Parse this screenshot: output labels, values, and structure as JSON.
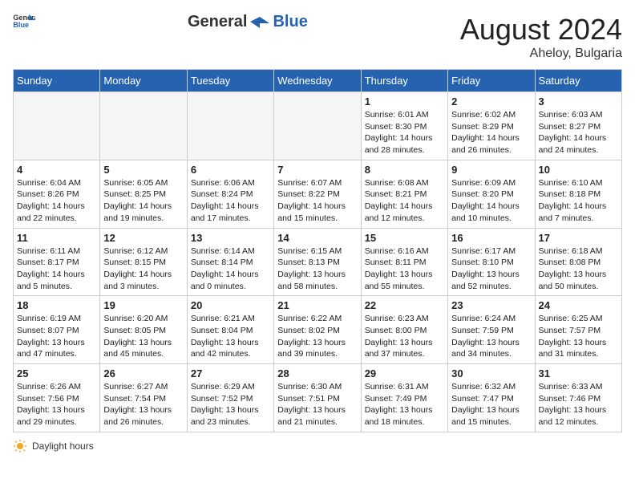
{
  "header": {
    "logo_general": "General",
    "logo_blue": "Blue",
    "month_year": "August 2024",
    "location": "Aheloy, Bulgaria"
  },
  "days_of_week": [
    "Sunday",
    "Monday",
    "Tuesday",
    "Wednesday",
    "Thursday",
    "Friday",
    "Saturday"
  ],
  "weeks": [
    [
      {
        "day": "",
        "sunrise": "",
        "sunset": "",
        "daylight": ""
      },
      {
        "day": "",
        "sunrise": "",
        "sunset": "",
        "daylight": ""
      },
      {
        "day": "",
        "sunrise": "",
        "sunset": "",
        "daylight": ""
      },
      {
        "day": "",
        "sunrise": "",
        "sunset": "",
        "daylight": ""
      },
      {
        "day": "1",
        "sunrise": "Sunrise: 6:01 AM",
        "sunset": "Sunset: 8:30 PM",
        "daylight": "Daylight: 14 hours and 28 minutes."
      },
      {
        "day": "2",
        "sunrise": "Sunrise: 6:02 AM",
        "sunset": "Sunset: 8:29 PM",
        "daylight": "Daylight: 14 hours and 26 minutes."
      },
      {
        "day": "3",
        "sunrise": "Sunrise: 6:03 AM",
        "sunset": "Sunset: 8:27 PM",
        "daylight": "Daylight: 14 hours and 24 minutes."
      }
    ],
    [
      {
        "day": "4",
        "sunrise": "Sunrise: 6:04 AM",
        "sunset": "Sunset: 8:26 PM",
        "daylight": "Daylight: 14 hours and 22 minutes."
      },
      {
        "day": "5",
        "sunrise": "Sunrise: 6:05 AM",
        "sunset": "Sunset: 8:25 PM",
        "daylight": "Daylight: 14 hours and 19 minutes."
      },
      {
        "day": "6",
        "sunrise": "Sunrise: 6:06 AM",
        "sunset": "Sunset: 8:24 PM",
        "daylight": "Daylight: 14 hours and 17 minutes."
      },
      {
        "day": "7",
        "sunrise": "Sunrise: 6:07 AM",
        "sunset": "Sunset: 8:22 PM",
        "daylight": "Daylight: 14 hours and 15 minutes."
      },
      {
        "day": "8",
        "sunrise": "Sunrise: 6:08 AM",
        "sunset": "Sunset: 8:21 PM",
        "daylight": "Daylight: 14 hours and 12 minutes."
      },
      {
        "day": "9",
        "sunrise": "Sunrise: 6:09 AM",
        "sunset": "Sunset: 8:20 PM",
        "daylight": "Daylight: 14 hours and 10 minutes."
      },
      {
        "day": "10",
        "sunrise": "Sunrise: 6:10 AM",
        "sunset": "Sunset: 8:18 PM",
        "daylight": "Daylight: 14 hours and 7 minutes."
      }
    ],
    [
      {
        "day": "11",
        "sunrise": "Sunrise: 6:11 AM",
        "sunset": "Sunset: 8:17 PM",
        "daylight": "Daylight: 14 hours and 5 minutes."
      },
      {
        "day": "12",
        "sunrise": "Sunrise: 6:12 AM",
        "sunset": "Sunset: 8:15 PM",
        "daylight": "Daylight: 14 hours and 3 minutes."
      },
      {
        "day": "13",
        "sunrise": "Sunrise: 6:14 AM",
        "sunset": "Sunset: 8:14 PM",
        "daylight": "Daylight: 14 hours and 0 minutes."
      },
      {
        "day": "14",
        "sunrise": "Sunrise: 6:15 AM",
        "sunset": "Sunset: 8:13 PM",
        "daylight": "Daylight: 13 hours and 58 minutes."
      },
      {
        "day": "15",
        "sunrise": "Sunrise: 6:16 AM",
        "sunset": "Sunset: 8:11 PM",
        "daylight": "Daylight: 13 hours and 55 minutes."
      },
      {
        "day": "16",
        "sunrise": "Sunrise: 6:17 AM",
        "sunset": "Sunset: 8:10 PM",
        "daylight": "Daylight: 13 hours and 52 minutes."
      },
      {
        "day": "17",
        "sunrise": "Sunrise: 6:18 AM",
        "sunset": "Sunset: 8:08 PM",
        "daylight": "Daylight: 13 hours and 50 minutes."
      }
    ],
    [
      {
        "day": "18",
        "sunrise": "Sunrise: 6:19 AM",
        "sunset": "Sunset: 8:07 PM",
        "daylight": "Daylight: 13 hours and 47 minutes."
      },
      {
        "day": "19",
        "sunrise": "Sunrise: 6:20 AM",
        "sunset": "Sunset: 8:05 PM",
        "daylight": "Daylight: 13 hours and 45 minutes."
      },
      {
        "day": "20",
        "sunrise": "Sunrise: 6:21 AM",
        "sunset": "Sunset: 8:04 PM",
        "daylight": "Daylight: 13 hours and 42 minutes."
      },
      {
        "day": "21",
        "sunrise": "Sunrise: 6:22 AM",
        "sunset": "Sunset: 8:02 PM",
        "daylight": "Daylight: 13 hours and 39 minutes."
      },
      {
        "day": "22",
        "sunrise": "Sunrise: 6:23 AM",
        "sunset": "Sunset: 8:00 PM",
        "daylight": "Daylight: 13 hours and 37 minutes."
      },
      {
        "day": "23",
        "sunrise": "Sunrise: 6:24 AM",
        "sunset": "Sunset: 7:59 PM",
        "daylight": "Daylight: 13 hours and 34 minutes."
      },
      {
        "day": "24",
        "sunrise": "Sunrise: 6:25 AM",
        "sunset": "Sunset: 7:57 PM",
        "daylight": "Daylight: 13 hours and 31 minutes."
      }
    ],
    [
      {
        "day": "25",
        "sunrise": "Sunrise: 6:26 AM",
        "sunset": "Sunset: 7:56 PM",
        "daylight": "Daylight: 13 hours and 29 minutes."
      },
      {
        "day": "26",
        "sunrise": "Sunrise: 6:27 AM",
        "sunset": "Sunset: 7:54 PM",
        "daylight": "Daylight: 13 hours and 26 minutes."
      },
      {
        "day": "27",
        "sunrise": "Sunrise: 6:29 AM",
        "sunset": "Sunset: 7:52 PM",
        "daylight": "Daylight: 13 hours and 23 minutes."
      },
      {
        "day": "28",
        "sunrise": "Sunrise: 6:30 AM",
        "sunset": "Sunset: 7:51 PM",
        "daylight": "Daylight: 13 hours and 21 minutes."
      },
      {
        "day": "29",
        "sunrise": "Sunrise: 6:31 AM",
        "sunset": "Sunset: 7:49 PM",
        "daylight": "Daylight: 13 hours and 18 minutes."
      },
      {
        "day": "30",
        "sunrise": "Sunrise: 6:32 AM",
        "sunset": "Sunset: 7:47 PM",
        "daylight": "Daylight: 13 hours and 15 minutes."
      },
      {
        "day": "31",
        "sunrise": "Sunrise: 6:33 AM",
        "sunset": "Sunset: 7:46 PM",
        "daylight": "Daylight: 13 hours and 12 minutes."
      }
    ]
  ],
  "footer": {
    "daylight_label": "Daylight hours"
  }
}
